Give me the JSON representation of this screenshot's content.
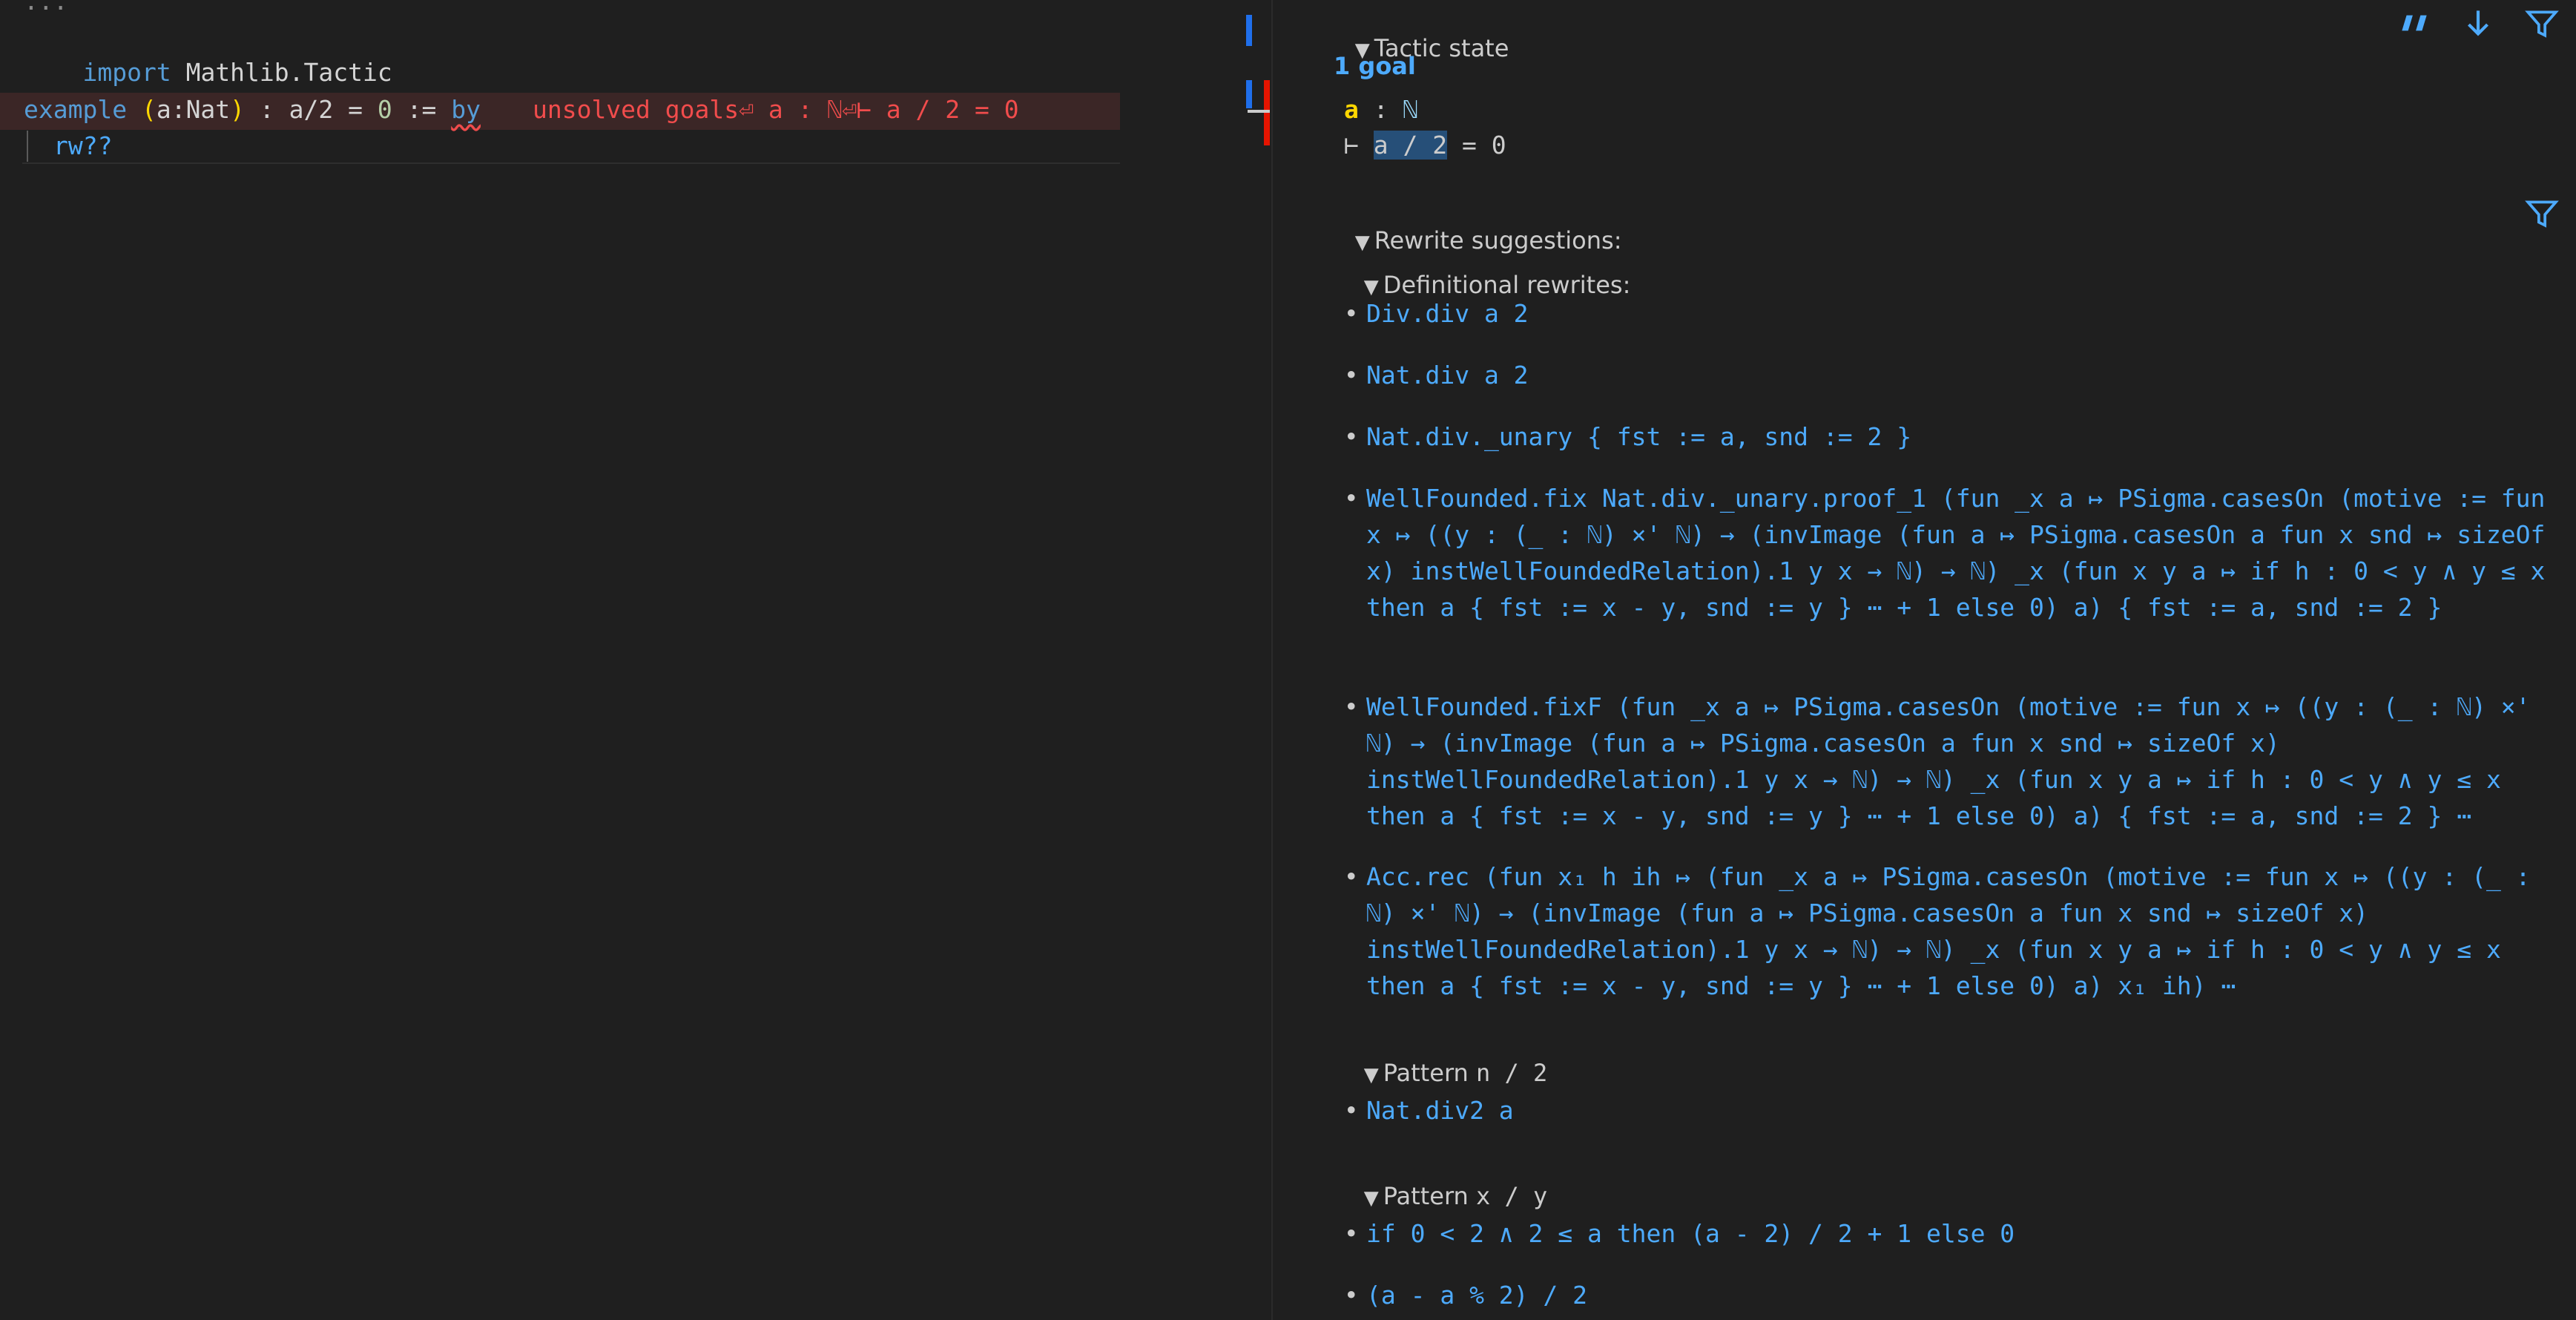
{
  "editor": {
    "fold_text": "...",
    "import_kw": "import",
    "import_module": "Mathlib.Tactic",
    "example_kw": "example",
    "binder_open": "(",
    "binder_name": "a:Nat",
    "binder_close": ")",
    "statement": " : a/2 = ",
    "statement_zero": "0",
    "assign": " := ",
    "by_kw": "by",
    "error_inline": "unsolved goals⏎ a : ℕ⏎⊢ a / 2 = 0",
    "rw_line": "rw??"
  },
  "infoview": {
    "tactic_state_title": "Tactic state",
    "goal_count": "1 goal",
    "hyp_name": "a",
    "hyp_colon": " : ",
    "hyp_type": "ℕ",
    "goal_turnstile": "⊢ ",
    "goal_highlight": "a / 2",
    "goal_rest": " = 0",
    "rewrite_title": "Rewrite suggestions:",
    "definitional_title": "Definitional rewrites:",
    "definitional_items": [
      "Div.div a 2",
      "Nat.div a 2",
      "Nat.div._unary { fst := a, snd := 2 }",
      "WellFounded.fix Nat.div._unary.proof_1 (fun _x a ↦ PSigma.casesOn (motive := fun x ↦ ((y : (_ : ℕ) ×' ℕ) → (invImage (fun a ↦ PSigma.casesOn a fun x snd ↦ sizeOf x) instWellFoundedRelation).1 y x → ℕ) → ℕ) _x (fun x y a ↦ if h : 0 < y ∧ y ≤ x then a { fst := x - y, snd := y } ⋯ + 1 else 0) a) { fst := a, snd := 2 }",
      "WellFounded.fixF (fun _x a ↦ PSigma.casesOn (motive := fun x ↦ ((y : (_ : ℕ) ×' ℕ) → (invImage (fun a ↦ PSigma.casesOn a fun x snd ↦ sizeOf x) instWellFoundedRelation).1 y x → ℕ) → ℕ) _x (fun x y a ↦ if h : 0 < y ∧ y ≤ x then a { fst := x - y, snd := y } ⋯ + 1 else 0) a) { fst := a, snd := 2 } ⋯",
      "Acc.rec (fun x₁ h ih ↦ (fun _x a ↦ PSigma.casesOn (motive := fun x ↦ ((y : (_ : ℕ) ×' ℕ) → (invImage (fun a ↦ PSigma.casesOn a fun x snd ↦ sizeOf x) instWellFoundedRelation).1 y x → ℕ) → ℕ) _x (fun x y a ↦ if h : 0 < y ∧ y ≤ x then a { fst := x - y, snd := y } ⋯ + 1 else 0) a) x₁ ih) ⋯"
    ],
    "pattern1_label": "Pattern ",
    "pattern1_expr": "n / 2",
    "pattern1_items": [
      "Nat.div2 a"
    ],
    "pattern2_label": "Pattern ",
    "pattern2_expr": "x / y",
    "pattern2_items": [
      "if 0 < 2 ∧ 2 ≤ a then (a - 2) / 2 + 1 else 0",
      "(a - a % 2) / 2"
    ],
    "toolbar": {
      "copy_icon": "quote-icon",
      "scroll_icon": "arrow-down-icon",
      "filter_icon": "filter-icon"
    }
  },
  "colors": {
    "accent_blue": "#4daafc",
    "error_red": "#f14c4c",
    "hyp_yellow": "#ffd700",
    "selection": "#264f78"
  }
}
